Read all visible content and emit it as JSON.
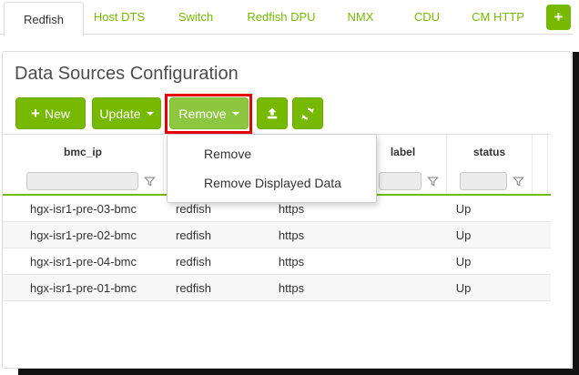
{
  "tabs": {
    "items": [
      {
        "label": "Redfish",
        "active": true
      },
      {
        "label": "Host DTS",
        "active": false
      },
      {
        "label": "Switch",
        "active": false
      },
      {
        "label": "Redfish DPU",
        "active": false
      },
      {
        "label": "NMX",
        "active": false
      },
      {
        "label": "CDU",
        "active": false
      },
      {
        "label": "CM HTTP",
        "active": false
      }
    ],
    "add_label": "+"
  },
  "page": {
    "title": "Data Sources Configuration"
  },
  "toolbar": {
    "plus_icon": "+",
    "new_label": "New",
    "update_label": "Update",
    "remove_label": "Remove",
    "annotation": {
      "shape": "red-rectangle",
      "around": "remove-button",
      "color": "#e60000"
    }
  },
  "remove_menu": {
    "open": true,
    "items": [
      {
        "label": "Remove"
      },
      {
        "label": "Remove Displayed Data"
      }
    ]
  },
  "table": {
    "columns": [
      {
        "label": "bmc_ip"
      },
      {
        "label": ""
      },
      {
        "label": ""
      },
      {
        "label": "label"
      },
      {
        "label": "status"
      }
    ],
    "filter_values": {
      "bmc_ip": "",
      "col2": "",
      "col3": "",
      "label": "",
      "status": ""
    },
    "rows": [
      [
        "hgx-isr1-pre-03-bmc",
        "redfish",
        "https",
        "",
        "Up"
      ],
      [
        "hgx-isr1-pre-02-bmc",
        "redfish",
        "https",
        "",
        "Up"
      ],
      [
        "hgx-isr1-pre-04-bmc",
        "redfish",
        "https",
        "",
        "Up"
      ],
      [
        "hgx-isr1-pre-01-bmc",
        "redfish",
        "https",
        "",
        "Up"
      ]
    ]
  },
  "colors": {
    "brand_green": "#76b900",
    "brand_green_light": "#8dc63f",
    "annotation_red": "#e60000",
    "tab_text_green": "#76b900",
    "stripe_gray": "#f7f7f7"
  }
}
